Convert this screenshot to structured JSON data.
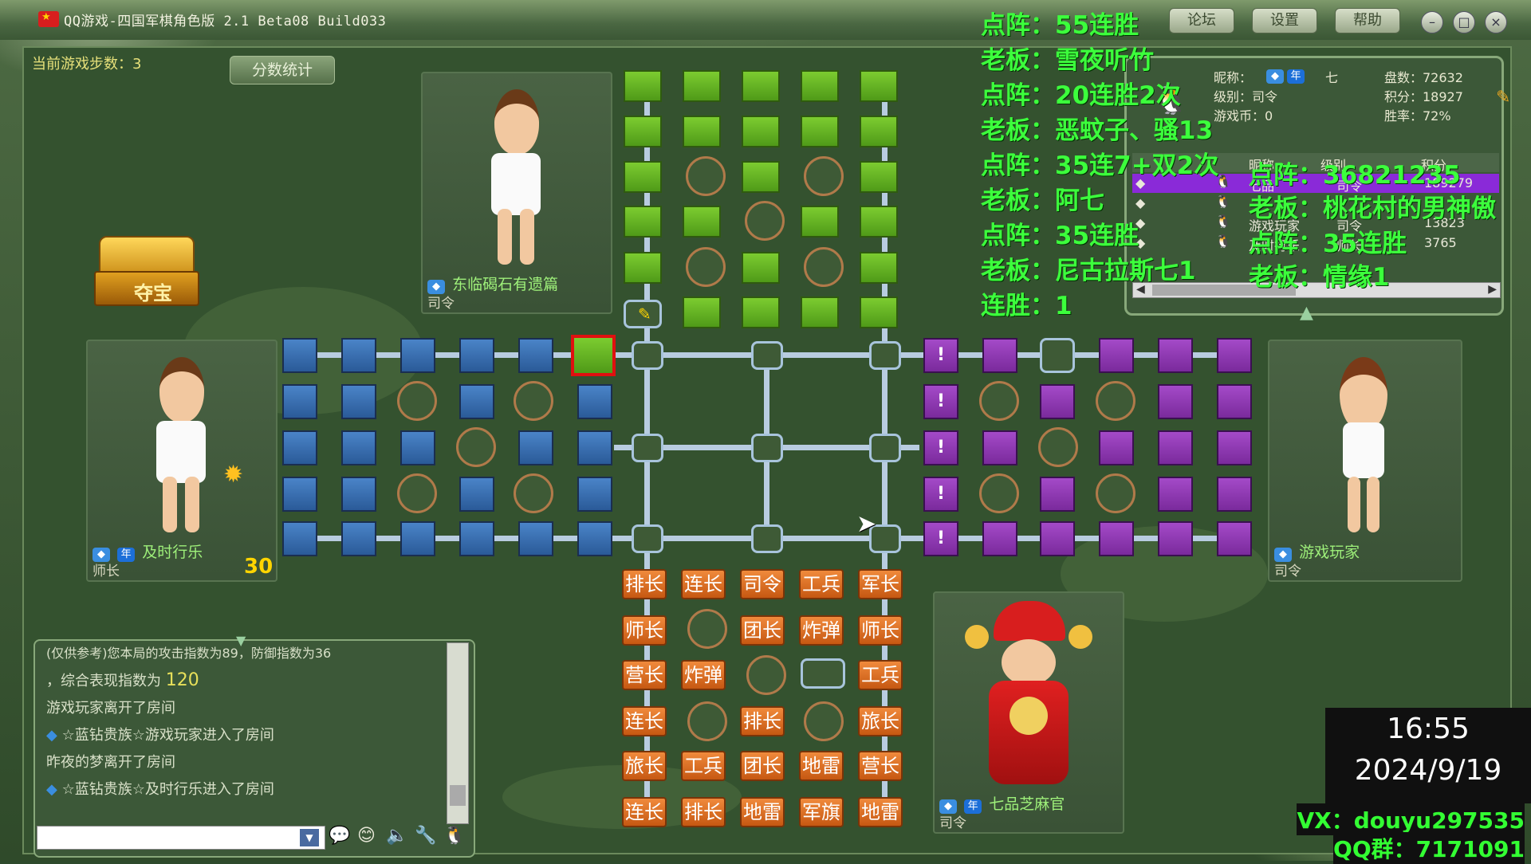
{
  "window": {
    "title": "QQ游戏-四国军棋角色版 2.1 Beta08 Build033",
    "buttons": [
      "论坛",
      "设置",
      "帮助"
    ]
  },
  "status": {
    "steps_label": "当前游戏步数：3",
    "score_button": "分数统计",
    "treasure": "夺宝"
  },
  "players": {
    "top": {
      "name": "东临碣石有遗篇",
      "rank": "司令"
    },
    "left": {
      "name": "及时行乐",
      "rank": "师长",
      "timer": "30"
    },
    "right": {
      "name": "游戏玩家",
      "rank": "司令"
    },
    "bottom": {
      "name": "七品芝麻官",
      "rank": "司令"
    }
  },
  "board": {
    "bottom_pieces": [
      [
        "排长",
        "连长",
        "司令",
        "工兵",
        "军长"
      ],
      [
        "师长",
        "",
        "团长",
        "炸弹",
        "师长"
      ],
      [
        "营长",
        "炸弹",
        "",
        "",
        "工兵"
      ],
      [
        "连长",
        "",
        "排长",
        "",
        "旅长"
      ],
      [
        "旅长",
        "工兵",
        "团长",
        "地雷",
        "营长"
      ],
      [
        "连长",
        "排长",
        "地雷",
        "军旗",
        "地雷"
      ]
    ],
    "alert_mark": "!"
  },
  "info_panel": {
    "nickname_label": "昵称：",
    "nickname": "七",
    "level": "级别：司令",
    "coins": "游戏币：0",
    "games": "盘数：72632",
    "points": "积分：18927",
    "winrate": "胜率：72%",
    "table_headers": [
      "昵称",
      "级别",
      "积分"
    ],
    "rows": [
      {
        "name": "七品",
        "rank": "司令",
        "score": "189279"
      },
      {
        "name": "",
        "rank": "",
        "score": ""
      },
      {
        "name": "游戏玩家",
        "rank": "司令",
        "score": "13823"
      },
      {
        "name": "及时行乐",
        "rank": "师长",
        "score": "3765"
      }
    ]
  },
  "overlay_left": [
    "点阵：55连胜",
    "老板：雪夜听竹",
    "点阵：20连胜2次",
    "老板：恶蚊子、骚13",
    "点阵：35连7+双2次",
    "老板：阿七",
    "点阵：35连胜",
    "老板：尼古拉斯七1",
    "连胜：1"
  ],
  "overlay_right": [
    "点阵：36821235",
    "老板：桃花村的男神傲",
    "点阵：35连胜",
    "老板：情缘1"
  ],
  "chat": {
    "lines": [
      "(仅供参考)您本局的攻击指数为89，防御指数为36",
      "，综合表现指数为",
      "游戏玩家离开了房间",
      "☆蓝钻贵族☆游戏玩家进入了房间",
      "昨夜的梦离开了房间",
      "☆蓝钻贵族☆及时行乐进入了房间"
    ],
    "score": "120"
  },
  "clock": {
    "time": "16:55",
    "date": "2024/9/19"
  },
  "watermark": {
    "vx": "VX：douyu297535",
    "qq": "QQ群：7171091"
  }
}
